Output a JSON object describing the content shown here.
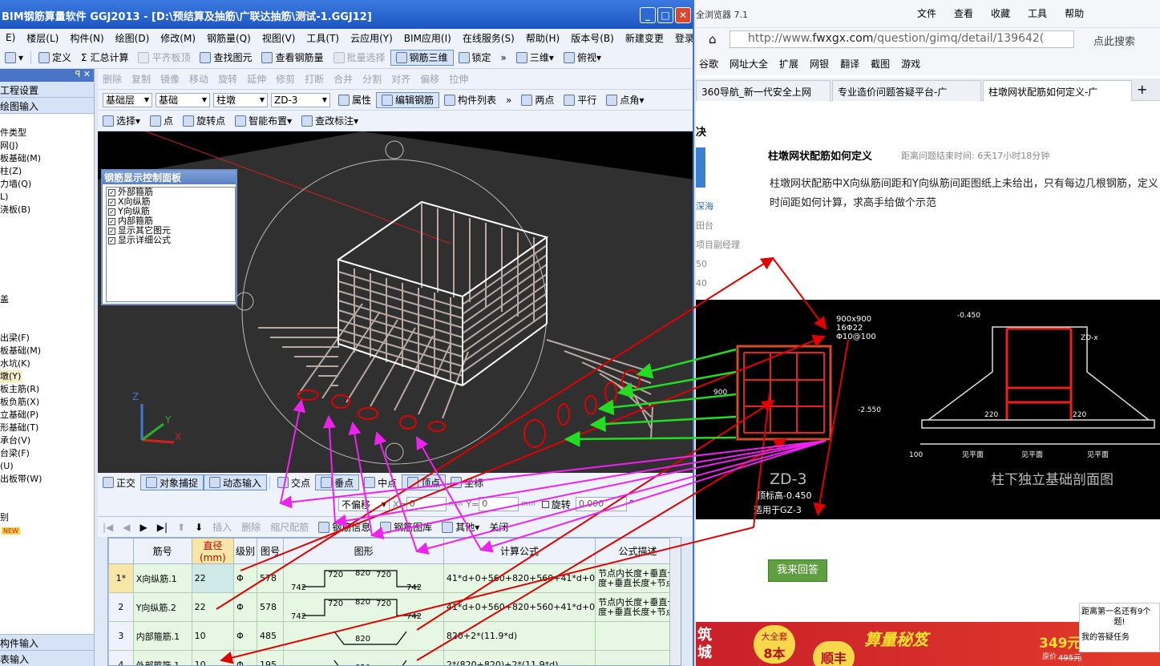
{
  "app": {
    "title": "BIM钢筋算量软件 GGJ2013 - [D:\\预结算及抽筋\\广联达抽筋\\测试-1.GGJ12]",
    "window_buttons": [
      "_",
      "□",
      "✕"
    ],
    "menu": [
      "E)",
      "楼层(L)",
      "构件(N)",
      "绘图(D)",
      "修改(M)",
      "钢筋量(Q)",
      "视图(V)",
      "工具(T)",
      "云应用(Y)",
      "BIM应用(I)",
      "在线服务(S)",
      "帮助(H)",
      "版本号(B)",
      "新建变更",
      "登录"
    ],
    "toolbar1": [
      "定义",
      "Σ 汇总计算",
      "平齐板顶",
      "查找图元",
      "查看钢筋量",
      "批量选择",
      "钢筋三维",
      "锁定",
      "三维",
      "俯视"
    ],
    "toolbar2": [
      "删除",
      "复制",
      "镜像",
      "移动",
      "旋转",
      "延伸",
      "修剪",
      "打断",
      "合并",
      "分割",
      "对齐",
      "偏移",
      "拉伸"
    ],
    "toolbar3": {
      "layer": "基础层",
      "category": "基础",
      "type": "柱墩",
      "item": "ZD-3",
      "buttons": [
        "属性",
        "编辑钢筋",
        "构件列表",
        "两点",
        "平行",
        "点角"
      ]
    },
    "toolbar4": [
      "选择",
      "点",
      "旋转点",
      "智能布置",
      "查改标注"
    ],
    "left_panel": {
      "pin": "ꟼ ✕",
      "sections": [
        "工程设置",
        "绘图输入"
      ],
      "items": [
        "件类型",
        "网(J)",
        "板基础(M)",
        "柱(Z)",
        "力墙(Q)",
        "L)",
        "浇板(B)",
        "",
        "",
        "",
        "",
        "",
        "",
        "盖",
        "",
        "",
        "出梁(F)",
        "板基础(M)",
        "水坑(K)",
        "墩(Y)",
        "板主筋(R)",
        "板负筋(X)",
        "立基础(P)",
        "形基础(T)",
        "承台(V)",
        "台梁(F)",
        "(U)",
        "出板带(W)",
        "",
        "",
        "别"
      ],
      "selected_index": 19,
      "new_badge": "NEW",
      "bottom": [
        "构件输入",
        "表输入"
      ]
    },
    "control_panel": {
      "title": "钢筋显示控制面板",
      "items": [
        "外部箍筋",
        "X向纵筋",
        "Y向纵筋",
        "内部箍筋",
        "显示其它图元",
        "显示详细公式"
      ]
    },
    "snap_bar": [
      "正交",
      "对象捕捉",
      "动态输入",
      "交点",
      "垂点",
      "中点",
      "顶点",
      "坐标"
    ],
    "offset_bar": {
      "mode": "不偏移",
      "x_label": "X=",
      "x_value": "0",
      "unit": "mm",
      "y_label": "Y=",
      "y_value": "0",
      "rotate_label": "旋转",
      "rotate_value": "0.000",
      "degree": "°"
    },
    "rebar_bar": [
      "插入",
      "删除",
      "缩尺配筋",
      "钢筋信息",
      "钢筋图库",
      "其他",
      "关闭"
    ],
    "table": {
      "headers": [
        "",
        "筋号",
        "直径(mm)",
        "级别",
        "图号",
        "图形",
        "计算公式",
        "公式描述"
      ],
      "rows": [
        {
          "num": "1*",
          "name": "X向纵筋.1",
          "dia": "22",
          "grade": "Φ",
          "fig": "578",
          "shape": {
            "l1": "742",
            "l2": "720",
            "mid": "820",
            "r2": "720",
            "r1": "742"
          },
          "formula": "41*d+0+560+820+560+41*d+0",
          "desc": "节点内长度+垂直长度+垂直长度+节点"
        },
        {
          "num": "2",
          "name": "Y向纵筋.2",
          "dia": "22",
          "grade": "Φ",
          "fig": "578",
          "shape": {
            "l1": "742",
            "l2": "720",
            "mid": "820",
            "r2": "720",
            "r1": "742"
          },
          "formula": "41*d+0+560+820+560+41*d+0",
          "desc": "节点内长度+垂直长度+垂直长度+节点"
        },
        {
          "num": "3",
          "name": "内部箍筋.1",
          "dia": "10",
          "grade": "Φ",
          "fig": "485",
          "shape": {
            "l1": "",
            "l2": "",
            "mid": "820",
            "r2": "",
            "r1": ""
          },
          "formula": "820+2*(11.9*d)",
          "desc": ""
        },
        {
          "num": "4",
          "name": "外部箍筋.1",
          "dia": "10",
          "grade": "Φ",
          "fig": "195",
          "shape": {
            "l1": "",
            "l2": "",
            "mid": "820",
            "r2": "",
            "r1": ""
          },
          "formula": "2*(820+820)+2*(11.9*d)",
          "desc": ""
        }
      ]
    }
  },
  "browser": {
    "title": "全浏览器 7.1",
    "menus": [
      "文件",
      "查看",
      "收藏",
      "工具",
      "帮助"
    ],
    "url_prefix": "http://www.",
    "url_domain": "fwxgx.com",
    "url_rest": "/question/gimq/detail/139642(",
    "search_placeholder": "点此搜索",
    "favorites": [
      "谷歌",
      "网址大全",
      "扩展",
      "网银",
      "翻译",
      "截图",
      "游戏"
    ],
    "tabs": [
      "360导航_新一代安全上网",
      "专业造价问题答疑平台-广",
      "柱墩网状配筋如何定义-广"
    ],
    "section_word": "决",
    "question_title": "柱墩网状配筋如何定义",
    "question_meta": "距离问题结束时间: 6天17小时18分钟",
    "question_body": "柱墩网状配筋中X向纵筋间距和Y向纵筋间距图纸上未给出，只有每边几根钢筋，定义时间距如何计算，求高手给做个示范",
    "user_info": [
      "深海",
      "田台",
      "项目副经理",
      "50",
      "40"
    ],
    "cad": {
      "size": "900x900",
      "rebar": "16Φ22",
      "stirrup": "Φ10@100",
      "elev_top": "-0.450",
      "elev_bottom": "-2.550",
      "section_label": "ZD-x",
      "dim_220": "220",
      "dim_100": "100",
      "dim_900": "900",
      "plan_text": "见平面",
      "name": "ZD-3",
      "top_elev": "顶标高-0.450",
      "applies_to": "适用于GZ-3",
      "section_title": "柱下独立基础剖面图"
    },
    "answer_button": "我来回答",
    "popup": [
      "距离第一名还有9个",
      "题!",
      "我的答疑任务"
    ],
    "ad": {
      "left": "筑城",
      "mid1": "大全套",
      "mid2": "8本",
      "mid3": "顺丰",
      "brand": "算量秘笈",
      "price": "349元",
      "orig_label": "原价",
      "orig_price": "495元"
    }
  },
  "colors": {
    "titlebar": "#1c55c2",
    "arrow_red": "#e00000",
    "arrow_green": "#22dd22",
    "arrow_magenta": "#ee22ee",
    "table_green": "#e6f7e4"
  }
}
